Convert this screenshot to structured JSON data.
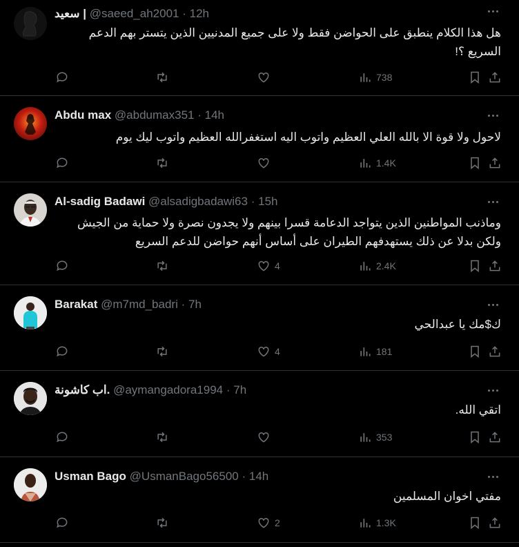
{
  "colors": {
    "background": "#000000",
    "text": "#e7e9ea",
    "muted": "#71767b",
    "divider": "#2f3336"
  },
  "tweets": [
    {
      "name": "سعيد |",
      "handle": "@saeed_ah2001",
      "time": "12h",
      "text": "هل هذا الكلام ينطبق على الحواضن فقط ولا على جميع المدنيين الذين يتستر بهم الدعم السريع ؟!",
      "likes": "",
      "views": "738"
    },
    {
      "name": "Abdu max",
      "handle": "@abdumax351",
      "time": "14h",
      "text": "لاحول ولا قوة الا بالله العلي العظيم واتوب اليه استغفرالله العظيم واتوب  ليك يوم",
      "likes": "",
      "views": "1.4K"
    },
    {
      "name": "Al-sadig Badawi",
      "handle": "@alsadigbadawi63",
      "time": "15h",
      "text": "وماذنب المواطنين الذين يتواجد الدعامة قسرا بينهم ولا يجدون نصرة ولا حماية من الجيش ولكن بدلا عن ذلك يستهدفهم الطيران على أساس أنهم حواضن للدعم السريع",
      "likes": "4",
      "views": "2.4K"
    },
    {
      "name": "Barakat",
      "handle": "@m7md_badri",
      "time": "7h",
      "text": "ك$مك يا عبدالحي",
      "likes": "4",
      "views": "181"
    },
    {
      "name": "اب كاشونة.",
      "handle": "@aymangadora1994",
      "time": "7h",
      "text": "اتقي الله.",
      "likes": "",
      "views": "353"
    },
    {
      "name": "Usman Bago",
      "handle": "@UsmanBago56500",
      "time": "14h",
      "text": "مفتي اخوان المسلمين",
      "likes": "2",
      "views": "1.3K"
    }
  ],
  "separator": "·",
  "icons": [
    "reply-icon",
    "retweet-icon",
    "like-icon",
    "views-icon",
    "bookmark-icon",
    "share-icon",
    "more-icon"
  ]
}
